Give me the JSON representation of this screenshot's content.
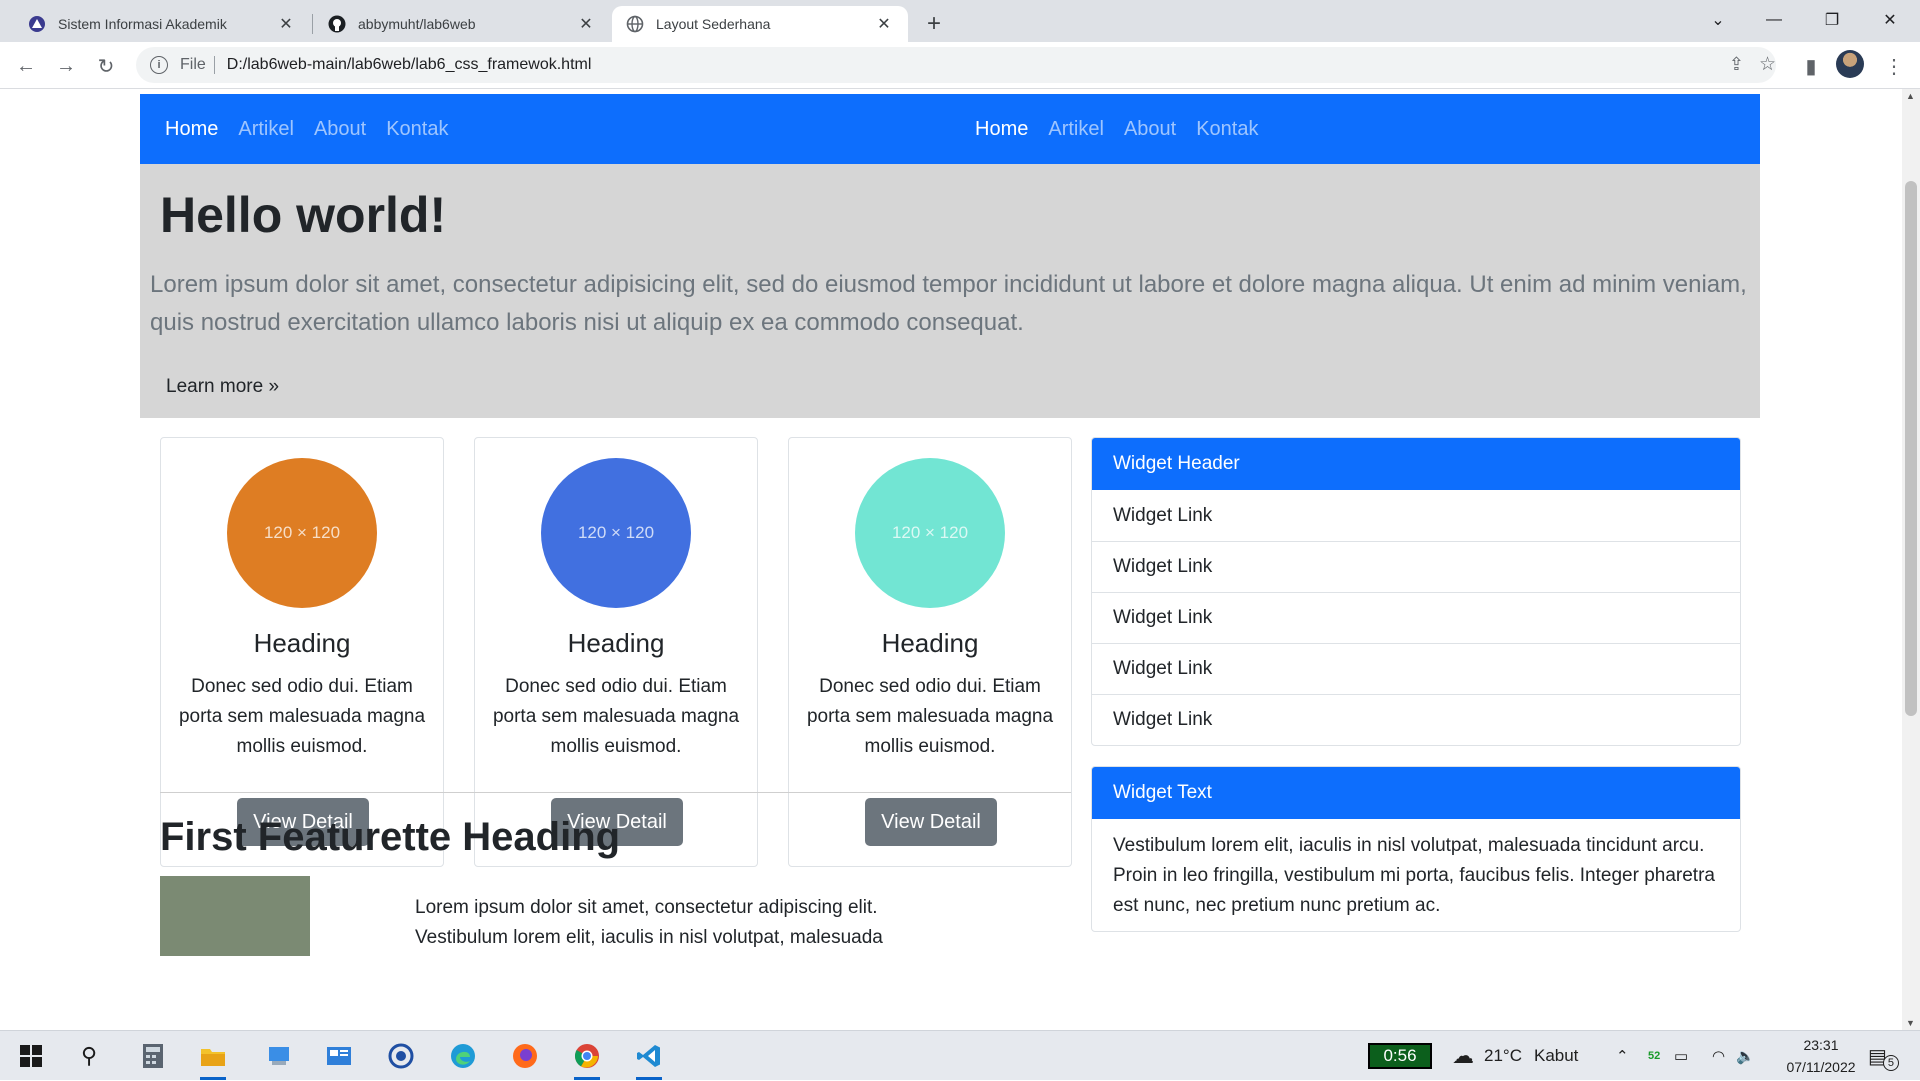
{
  "browser": {
    "tabs": [
      {
        "title": "Sistem Informasi Akademik",
        "active": false,
        "icon": "university-logo-icon"
      },
      {
        "title": "abbymuht/lab6web",
        "active": false,
        "icon": "github-icon"
      },
      {
        "title": "Layout Sederhana",
        "active": true,
        "icon": "globe-icon"
      }
    ],
    "address": {
      "scheme": "File",
      "path": "D:/lab6web-main/lab6web/lab6_css_framewok.html"
    }
  },
  "page": {
    "nav_left": [
      "Home",
      "Artikel",
      "About",
      "Kontak"
    ],
    "nav_right": [
      "Home",
      "Artikel",
      "About",
      "Kontak"
    ],
    "jumbotron": {
      "title": "Hello world!",
      "text": "Lorem ipsum dolor sit amet, consectetur adipisicing elit, sed do eiusmod tempor incididunt ut labore et dolore magna aliqua. Ut enim ad minim veniam, quis nostrud exercitation ullamco laboris nisi ut aliquip ex ea commodo consequat.",
      "button": "Learn more »"
    },
    "cards": [
      {
        "placeholder": "120 × 120",
        "color": "#de7d23",
        "heading": "Heading",
        "text": "Donec sed odio dui. Etiam porta sem malesuada magna mollis euismod.",
        "button": "View Detail"
      },
      {
        "placeholder": "120 × 120",
        "color": "#4170e0",
        "heading": "Heading",
        "text": "Donec sed odio dui. Etiam porta sem malesuada magna mollis euismod.",
        "button": "View Detail"
      },
      {
        "placeholder": "120 × 120",
        "color": "#72e5d3",
        "heading": "Heading",
        "text": "Donec sed odio dui. Etiam porta sem malesuada magna mollis euismod.",
        "button": "View Detail"
      }
    ],
    "widget_links": {
      "header": "Widget Header",
      "links": [
        "Widget Link",
        "Widget Link",
        "Widget Link",
        "Widget Link",
        "Widget Link"
      ]
    },
    "widget_text": {
      "header": "Widget Text",
      "text": "Vestibulum lorem elit, iaculis in nisl volutpat, malesuada tincidunt arcu. Proin in leo fringilla, vestibulum mi porta, faucibus felis. Integer pharetra est nunc, nec pretium nunc pretium ac."
    },
    "featurette": {
      "heading": "First Featurette Heading",
      "text": "Lorem ipsum dolor sit amet, consectetur adipiscing elit. Vestibulum lorem elit, iaculis in nisl volutpat, malesuada"
    }
  },
  "taskbar": {
    "timer": "0:56",
    "weather": {
      "temp": "21°C",
      "condition": "Kabut"
    },
    "battery_badge": "52",
    "time": "23:31",
    "date": "07/11/2022",
    "notification_count": "5"
  },
  "colors": {
    "primary": "#0d6efd",
    "secondary_button": "#6c757d",
    "jumbotron_bg": "#d6d6d6"
  }
}
